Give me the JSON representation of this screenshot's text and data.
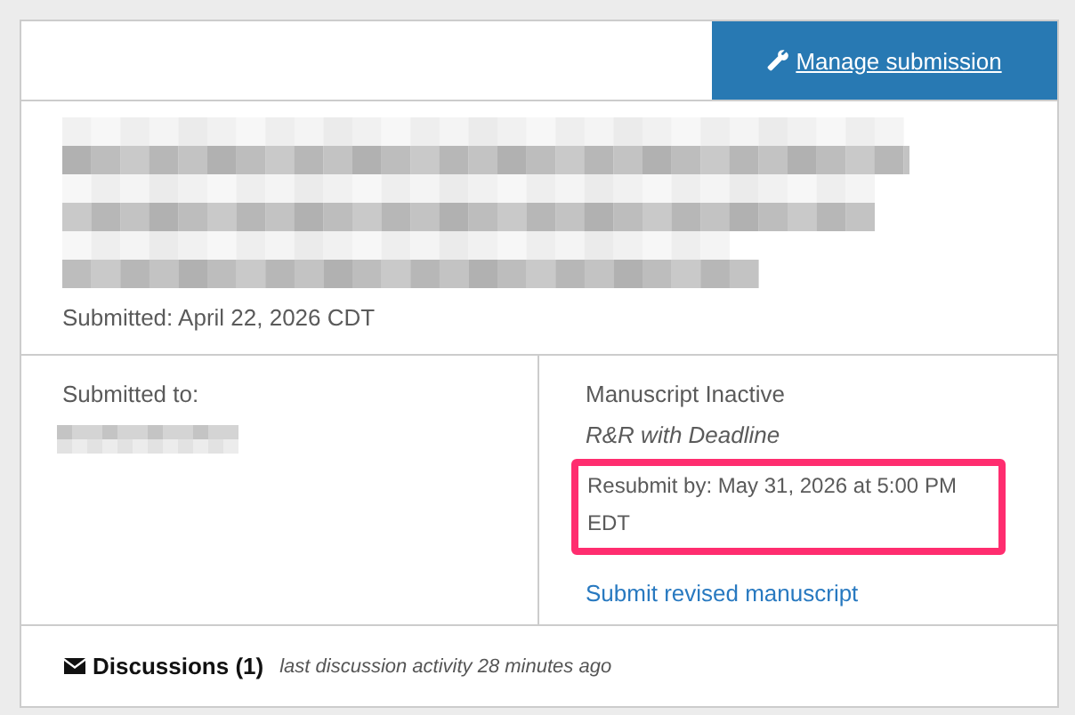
{
  "header": {
    "manage_button": "Manage submission"
  },
  "submission": {
    "submitted": "Submitted: April 22, 2026 CDT"
  },
  "details": {
    "submitted_to_label": "Submitted to:",
    "status": "Manuscript Inactive",
    "decision": "R&R with Deadline",
    "resubmit": {
      "text": "Resubmit by: May 31, 2026 at 5:00 PM EDT",
      "highlighted": true
    },
    "revise_link": "Submit revised manuscript"
  },
  "footer": {
    "title": "Discussions (1)",
    "activity": "last discussion activity 28 minutes ago"
  }
}
